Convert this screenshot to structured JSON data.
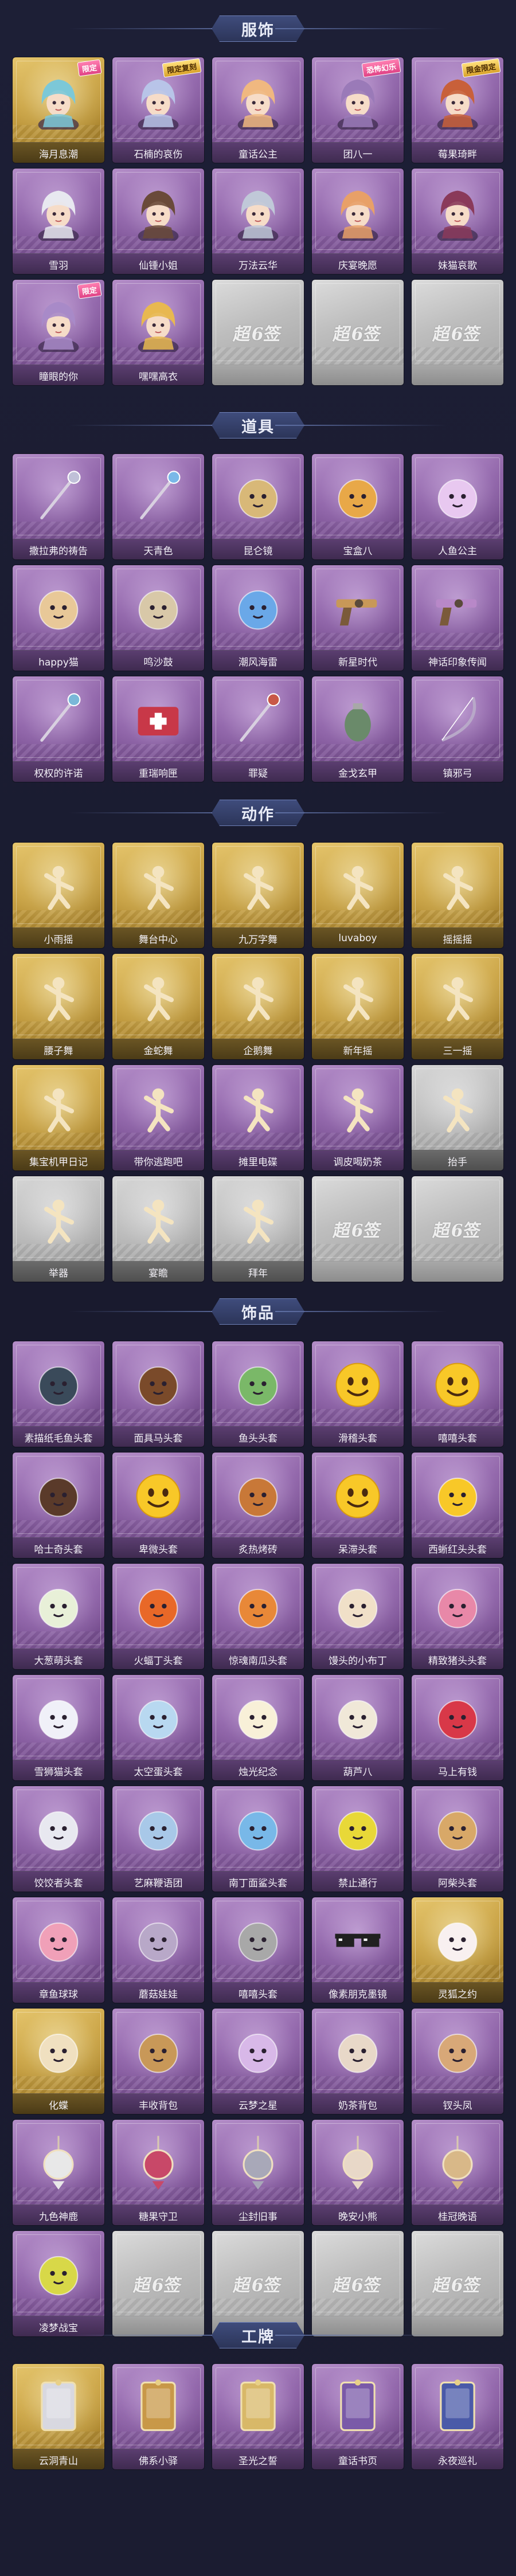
{
  "sections": {
    "costumes": {
      "title": "服饰"
    },
    "props": {
      "title": "道具"
    },
    "actions": {
      "title": "动作"
    },
    "accessories": {
      "title": "饰品"
    },
    "nameplates": {
      "title": "工牌"
    }
  },
  "placeholder_text": "超6签",
  "badges": {
    "limited": "限定",
    "limited_return": "限定复刻",
    "fearsome": "恐怖幻乐",
    "limited_gold": "限金限定"
  },
  "costumes": [
    {
      "label": "海月息潮",
      "rarity": "gold",
      "icon": "character-portrait-icon",
      "badge": "限定",
      "badgeType": "pink",
      "hue": "#7cc8d8"
    },
    {
      "label": "石楠的哀伤",
      "rarity": "purple",
      "icon": "character-portrait-icon",
      "badge": "限定复刻",
      "badgeType": "gold",
      "hue": "#b8c4e8"
    },
    {
      "label": "童话公主",
      "rarity": "purple",
      "icon": "character-portrait-icon",
      "hue": "#f0b880"
    },
    {
      "label": "团八一",
      "rarity": "purple",
      "icon": "character-portrait-icon",
      "badge": "恐怖幻乐",
      "badgeType": "pink",
      "hue": "#9a7ab8"
    },
    {
      "label": "莓果琦畔",
      "rarity": "purple",
      "icon": "character-portrait-icon",
      "badge": "限金限定",
      "badgeType": "gold",
      "hue": "#c8603a"
    },
    {
      "label": "雪羽",
      "rarity": "purple",
      "icon": "character-portrait-icon",
      "hue": "#e8e8f0"
    },
    {
      "label": "仙锺小姐",
      "rarity": "purple",
      "icon": "character-portrait-icon",
      "hue": "#6a4a3a"
    },
    {
      "label": "万法云华",
      "rarity": "purple",
      "icon": "character-portrait-icon",
      "hue": "#c0c8d8"
    },
    {
      "label": "庆宴晚愿",
      "rarity": "purple",
      "icon": "character-portrait-icon",
      "hue": "#e8a068"
    },
    {
      "label": "妹猫哀歌",
      "rarity": "purple",
      "icon": "character-portrait-icon",
      "hue": "#8a3a5a"
    },
    {
      "label": "瞳眼的你",
      "rarity": "purple",
      "icon": "character-portrait-icon",
      "badge": "限定",
      "badgeType": "pink",
      "hue": "#a88ac8"
    },
    {
      "label": "嘿嘿高衣",
      "rarity": "purple",
      "icon": "character-portrait-icon",
      "hue": "#e8b850"
    },
    {
      "placeholder": true
    },
    {
      "placeholder": true
    },
    {
      "placeholder": true
    }
  ],
  "props": [
    {
      "label": "撒拉弗的祷告",
      "rarity": "purple",
      "icon": "staff-icon",
      "hue": "#c0c0d8"
    },
    {
      "label": "天青色",
      "rarity": "purple",
      "icon": "wand-icon",
      "hue": "#7ab8e8"
    },
    {
      "label": "昆仑镜",
      "rarity": "purple",
      "icon": "mirror-icon",
      "hue": "#d8b878"
    },
    {
      "label": "宝盒八",
      "rarity": "purple",
      "icon": "heart-box-icon",
      "hue": "#e8a848"
    },
    {
      "label": "人鱼公主",
      "rarity": "purple",
      "icon": "shell-icon",
      "hue": "#e8c8f0"
    },
    {
      "label": "happy猫",
      "rarity": "purple",
      "icon": "cat-figure-icon",
      "hue": "#e8c898"
    },
    {
      "label": "鸣沙鼓",
      "rarity": "purple",
      "icon": "dreamcatcher-icon",
      "hue": "#d8c8a8"
    },
    {
      "label": "潮风海雷",
      "rarity": "purple",
      "icon": "lantern-icon",
      "hue": "#6aa8e8"
    },
    {
      "label": "新星时代",
      "rarity": "purple",
      "icon": "revolver-icon",
      "hue": "#c89858"
    },
    {
      "label": "神话印象传闻",
      "rarity": "purple",
      "icon": "rifle-icon",
      "hue": "#b888c8"
    },
    {
      "label": "权权的许诺",
      "rarity": "purple",
      "icon": "scepter-icon",
      "hue": "#7ab8d8"
    },
    {
      "label": "重瑞响匣",
      "rarity": "purple",
      "icon": "medkit-icon",
      "hue": "#c83848"
    },
    {
      "label": "罪疑",
      "rarity": "purple",
      "icon": "spear-icon",
      "hue": "#c85848"
    },
    {
      "label": "金戈玄甲",
      "rarity": "purple",
      "icon": "grenade-icon",
      "hue": "#6a8a6a"
    },
    {
      "label": "镇邪弓",
      "rarity": "purple",
      "icon": "bow-icon",
      "hue": "#b8a8c8"
    }
  ],
  "actions": [
    {
      "label": "小雨摇",
      "rarity": "gold",
      "icon": "dance-pose-icon"
    },
    {
      "label": "舞台中心",
      "rarity": "gold",
      "icon": "dance-pose-icon"
    },
    {
      "label": "九万字舞",
      "rarity": "gold",
      "icon": "dance-pose-icon"
    },
    {
      "label": "luvaboy",
      "rarity": "gold",
      "icon": "dance-pose-icon"
    },
    {
      "label": "摇摇摇",
      "rarity": "gold",
      "icon": "dance-pose-icon"
    },
    {
      "label": "腰子舞",
      "rarity": "gold",
      "icon": "dance-pose-icon"
    },
    {
      "label": "金蛇舞",
      "rarity": "gold",
      "icon": "dance-pose-icon"
    },
    {
      "label": "企鹅舞",
      "rarity": "gold",
      "icon": "dance-pose-icon"
    },
    {
      "label": "新年摇",
      "rarity": "gold",
      "icon": "dance-pose-icon"
    },
    {
      "label": "三一摇",
      "rarity": "gold",
      "icon": "dance-pose-icon"
    },
    {
      "label": "集宝机甲日记",
      "rarity": "gold",
      "icon": "dance-pose-icon"
    },
    {
      "label": "带你逃跑吧",
      "rarity": "purple",
      "icon": "dance-pose-icon"
    },
    {
      "label": "摊里电碟",
      "rarity": "purple",
      "icon": "dance-pose-icon"
    },
    {
      "label": "调皮喝奶茶",
      "rarity": "purple",
      "icon": "dance-pose-icon"
    },
    {
      "label": "抬手",
      "rarity": "gray",
      "icon": "dance-pose-icon"
    },
    {
      "label": "举器",
      "rarity": "gray",
      "icon": "dance-pose-icon"
    },
    {
      "label": "宴瞻",
      "rarity": "gray",
      "icon": "dance-pose-icon"
    },
    {
      "label": "拜年",
      "rarity": "gray",
      "icon": "dance-pose-icon"
    },
    {
      "placeholder": true
    },
    {
      "placeholder": true
    }
  ],
  "accessories": [
    {
      "label": "素描纸毛鱼头套",
      "rarity": "purple",
      "icon": "round-head-icon",
      "hue": "#3a4a5a"
    },
    {
      "label": "面具马头套",
      "rarity": "purple",
      "icon": "round-head-icon",
      "hue": "#7a4a2a"
    },
    {
      "label": "鱼头头套",
      "rarity": "purple",
      "icon": "round-head-icon",
      "hue": "#7ab868"
    },
    {
      "label": "滑稽头套",
      "rarity": "purple",
      "icon": "smiley-icon",
      "hue": "#f8c828"
    },
    {
      "label": "嘻嘻头套",
      "rarity": "purple",
      "icon": "smiley-icon",
      "hue": "#f8c828"
    },
    {
      "label": "哈士奇头套",
      "rarity": "purple",
      "icon": "round-head-icon",
      "hue": "#5a3a2a"
    },
    {
      "label": "卑微头套",
      "rarity": "purple",
      "icon": "smiley-icon",
      "hue": "#f8c828"
    },
    {
      "label": "炙热烤砖",
      "rarity": "purple",
      "icon": "round-head-icon",
      "hue": "#c87838"
    },
    {
      "label": "呆滞头套",
      "rarity": "purple",
      "icon": "smiley-icon",
      "hue": "#f8c828"
    },
    {
      "label": "西蜥红头头套",
      "rarity": "purple",
      "icon": "round-head-icon",
      "hue": "#f8c828"
    },
    {
      "label": "大葱萌头套",
      "rarity": "purple",
      "icon": "round-head-icon",
      "hue": "#e8f0d8"
    },
    {
      "label": "火蝠丁头套",
      "rarity": "purple",
      "icon": "round-head-icon",
      "hue": "#e86828"
    },
    {
      "label": "惊魂南瓜头套",
      "rarity": "purple",
      "icon": "round-head-icon",
      "hue": "#e88838"
    },
    {
      "label": "馒头的小布丁",
      "rarity": "purple",
      "icon": "round-head-icon",
      "hue": "#f0e0c8"
    },
    {
      "label": "精致猪头头套",
      "rarity": "purple",
      "icon": "round-head-icon",
      "hue": "#e888a8"
    },
    {
      "label": "雪狮猫头套",
      "rarity": "purple",
      "icon": "round-head-icon",
      "hue": "#f0f0f8"
    },
    {
      "label": "太空蛋头套",
      "rarity": "purple",
      "icon": "round-head-icon",
      "hue": "#b8d8f0"
    },
    {
      "label": "烛光纪念",
      "rarity": "purple",
      "icon": "round-head-icon",
      "hue": "#f8f0d8"
    },
    {
      "label": "葫芦八",
      "rarity": "purple",
      "icon": "round-head-icon",
      "hue": "#f0e8d8"
    },
    {
      "label": "马上有钱",
      "rarity": "purple",
      "icon": "round-head-icon",
      "hue": "#d83848"
    },
    {
      "label": "饺饺者头套",
      "rarity": "purple",
      "icon": "round-head-icon",
      "hue": "#e8e8f0"
    },
    {
      "label": "艺麻鞭语团",
      "rarity": "purple",
      "icon": "round-head-icon",
      "hue": "#a8c8e8"
    },
    {
      "label": "南丁面鲨头套",
      "rarity": "purple",
      "icon": "round-head-icon",
      "hue": "#78b8e8"
    },
    {
      "label": "禁止通行",
      "rarity": "purple",
      "icon": "round-head-icon",
      "hue": "#e8d838"
    },
    {
      "label": "阿柴头套",
      "rarity": "purple",
      "icon": "round-head-icon",
      "hue": "#d8a868"
    },
    {
      "label": "章鱼球球",
      "rarity": "purple",
      "icon": "round-head-icon",
      "hue": "#f0a0b8"
    },
    {
      "label": "蘑菇娃娃",
      "rarity": "purple",
      "icon": "round-head-icon",
      "hue": "#b8a8c8"
    },
    {
      "label": "嘻嘻头套",
      "rarity": "purple",
      "icon": "round-head-icon",
      "hue": "#a8a8a8"
    },
    {
      "label": "像素朋克墨镜",
      "rarity": "purple",
      "icon": "sunglasses-icon",
      "hue": "#202020"
    },
    {
      "label": "灵狐之约",
      "rarity": "gold",
      "icon": "round-head-icon",
      "hue": "#f8f0f0"
    },
    {
      "label": "化蝶",
      "rarity": "gold",
      "icon": "round-head-icon",
      "hue": "#f0e0c0"
    },
    {
      "label": "丰收背包",
      "rarity": "purple",
      "icon": "round-head-icon",
      "hue": "#c89858"
    },
    {
      "label": "云梦之星",
      "rarity": "purple",
      "icon": "round-head-icon",
      "hue": "#d8b8e8"
    },
    {
      "label": "奶茶背包",
      "rarity": "purple",
      "icon": "round-head-icon",
      "hue": "#e8d8c8"
    },
    {
      "label": "钗头凤",
      "rarity": "purple",
      "icon": "round-head-icon",
      "hue": "#d8a878"
    },
    {
      "label": "九色神鹿",
      "rarity": "purple",
      "icon": "ornament-icon",
      "hue": "#e8e8e8"
    },
    {
      "label": "糖果守卫",
      "rarity": "purple",
      "icon": "ornament-icon",
      "hue": "#c84868"
    },
    {
      "label": "尘封旧事",
      "rarity": "purple",
      "icon": "ornament-icon",
      "hue": "#a8a8b8"
    },
    {
      "label": "晚安小熊",
      "rarity": "purple",
      "icon": "ornament-icon",
      "hue": "#e8d8c8"
    },
    {
      "label": "桂冠晚语",
      "rarity": "purple",
      "icon": "ornament-icon",
      "hue": "#d8b888"
    },
    {
      "label": "凌梦战宝",
      "rarity": "purple",
      "icon": "round-head-icon",
      "hue": "#d8d848"
    },
    {
      "placeholder": true
    },
    {
      "placeholder": true
    },
    {
      "placeholder": true
    },
    {
      "placeholder": true
    }
  ],
  "nameplates": [
    {
      "label": "云洞青山",
      "rarity": "gold",
      "icon": "nameplate-icon",
      "hue": "#d8d8e0"
    },
    {
      "label": "佛系小驿",
      "rarity": "purple",
      "icon": "nameplate-icon",
      "hue": "#c89848"
    },
    {
      "label": "圣光之誓",
      "rarity": "purple",
      "icon": "nameplate-icon",
      "hue": "#d8b868"
    },
    {
      "label": "童话书页",
      "rarity": "purple",
      "icon": "nameplate-icon",
      "hue": "#7a5aa8"
    },
    {
      "label": "永夜巡礼",
      "rarity": "purple",
      "icon": "nameplate-icon",
      "hue": "#4a5aa8"
    }
  ]
}
